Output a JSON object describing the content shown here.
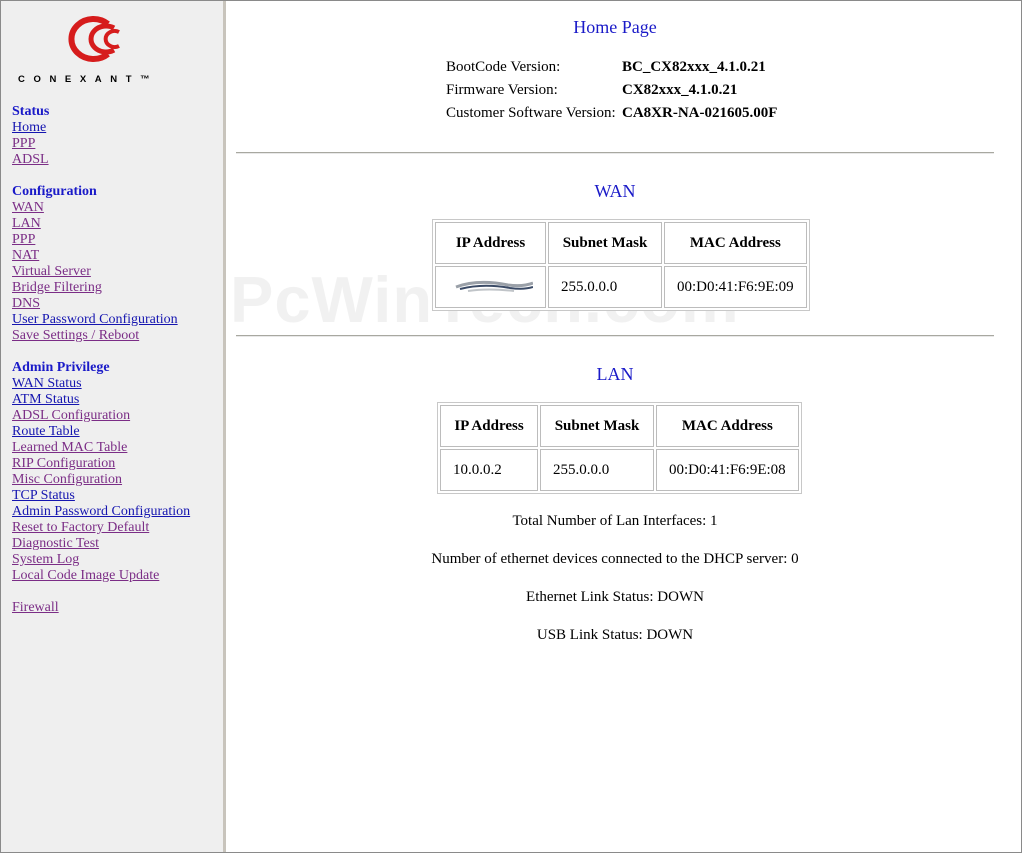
{
  "brand": {
    "logo_text": "CONEXANT™",
    "accent": "#d61c1c"
  },
  "sidebar": {
    "sections": [
      {
        "heading": "Status",
        "links": [
          "Home",
          "PPP",
          "ADSL"
        ]
      },
      {
        "heading": "Configuration",
        "links": [
          "WAN",
          "LAN",
          "PPP",
          "NAT",
          "Virtual Server",
          "Bridge Filtering",
          "DNS",
          "User Password Configuration",
          "Save Settings / Reboot"
        ]
      },
      {
        "heading": "Admin Privilege",
        "links": [
          "WAN Status",
          "ATM Status",
          "ADSL Configuration",
          "Route Table",
          "Learned MAC Table",
          "RIP Configuration",
          "Misc Configuration",
          "TCP Status",
          "Admin Password Configuration",
          "Reset to Factory Default",
          "Diagnostic Test",
          "System Log",
          "Local Code Image Update"
        ]
      },
      {
        "heading": "",
        "links": [
          "Firewall"
        ]
      }
    ]
  },
  "main": {
    "title": "Home Page",
    "versions": [
      {
        "label": "BootCode Version:",
        "value": "BC_CX82xxx_4.1.0.21"
      },
      {
        "label": "Firmware Version:",
        "value": "CX82xxx_4.1.0.21"
      },
      {
        "label": "Customer Software Version:",
        "value": "CA8XR-NA-021605.00F"
      }
    ],
    "wan": {
      "title": "WAN",
      "headers": [
        "IP Address",
        "Subnet Mask",
        "MAC Address"
      ],
      "row": [
        "",
        "255.0.0.0",
        "00:D0:41:F6:9E:09"
      ]
    },
    "lan": {
      "title": "LAN",
      "headers": [
        "IP Address",
        "Subnet Mask",
        "MAC Address"
      ],
      "row": [
        "10.0.0.2",
        "255.0.0.0",
        "00:D0:41:F6:9E:08"
      ]
    },
    "status_lines": [
      "Total Number of Lan Interfaces: 1",
      "Number of ethernet devices connected to the DHCP server: 0",
      "Ethernet Link Status: DOWN",
      "USB Link Status: DOWN"
    ]
  },
  "watermark": "PcWinTech.com"
}
